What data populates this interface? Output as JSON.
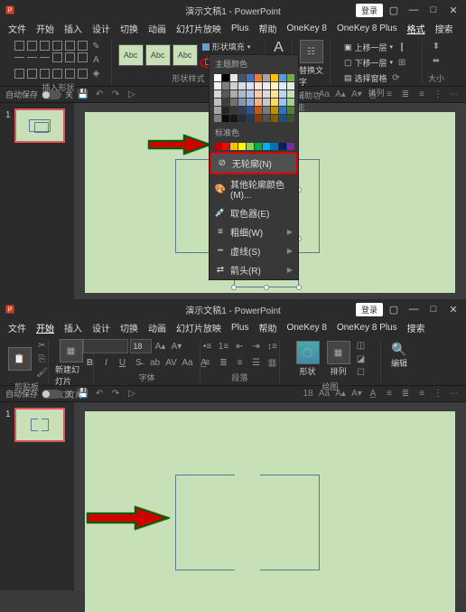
{
  "top": {
    "titlebar": {
      "title": "演示文稿1 - PowerPoint",
      "login": "登录"
    },
    "menu": {
      "file": "文件",
      "home": "开始",
      "insert": "插入",
      "design": "设计",
      "transitions": "切换",
      "animations": "动画",
      "slideshow": "幻灯片放映",
      "plus": "Plus",
      "help": "帮助",
      "ok8": "OneKey 8",
      "ok8p": "OneKey 8 Plus",
      "format": "格式",
      "search": "搜索"
    },
    "ribbon": {
      "insert_shape": "插入形状",
      "shape_styles": "形状样式",
      "style_label": "Abc",
      "shape_fill": "形状填充",
      "shape_outline": "形状轮廓",
      "wordart": "A",
      "accessibility": "辅助功能",
      "accessibility_btn": "替换文字",
      "arrange": "排列",
      "bring_forward": "上移一层",
      "send_backward": "下移一层",
      "selection_pane": "选择窗格",
      "size": "大小"
    },
    "autosave": {
      "label": "自动保存",
      "state": "关"
    },
    "dropdown": {
      "theme_colors": "主题颜色",
      "standard_colors": "标准色",
      "no_outline": "无轮廓(N)",
      "more_colors": "其他轮廓颜色(M)...",
      "eyedropper": "取色器(E)",
      "weight": "粗细(W)",
      "dashes": "虚线(S)",
      "arrows": "箭头(R)"
    },
    "thumb_num": "1"
  },
  "bottom": {
    "titlebar": {
      "title": "演示文稿1 - PowerPoint",
      "login": "登录"
    },
    "menu": {
      "file": "文件",
      "home": "开始",
      "insert": "插入",
      "design": "设计",
      "transitions": "切换",
      "animations": "动画",
      "slideshow": "幻灯片放映",
      "plus": "Plus",
      "help": "帮助",
      "ok8": "OneKey 8",
      "ok8p": "OneKey 8 Plus",
      "search": "搜索"
    },
    "ribbon": {
      "clipboard": "剪贴板",
      "paste": "粘贴",
      "slides": "幻灯片",
      "new_slide": "新建幻灯片",
      "font": "字体",
      "font_size": "18",
      "paragraph": "段落",
      "shapes": "形状",
      "arrange": "排列",
      "drawing": "绘图",
      "editing": "编辑"
    },
    "autosave": {
      "label": "自动保存",
      "state": "关"
    },
    "thumb_num": "1"
  }
}
